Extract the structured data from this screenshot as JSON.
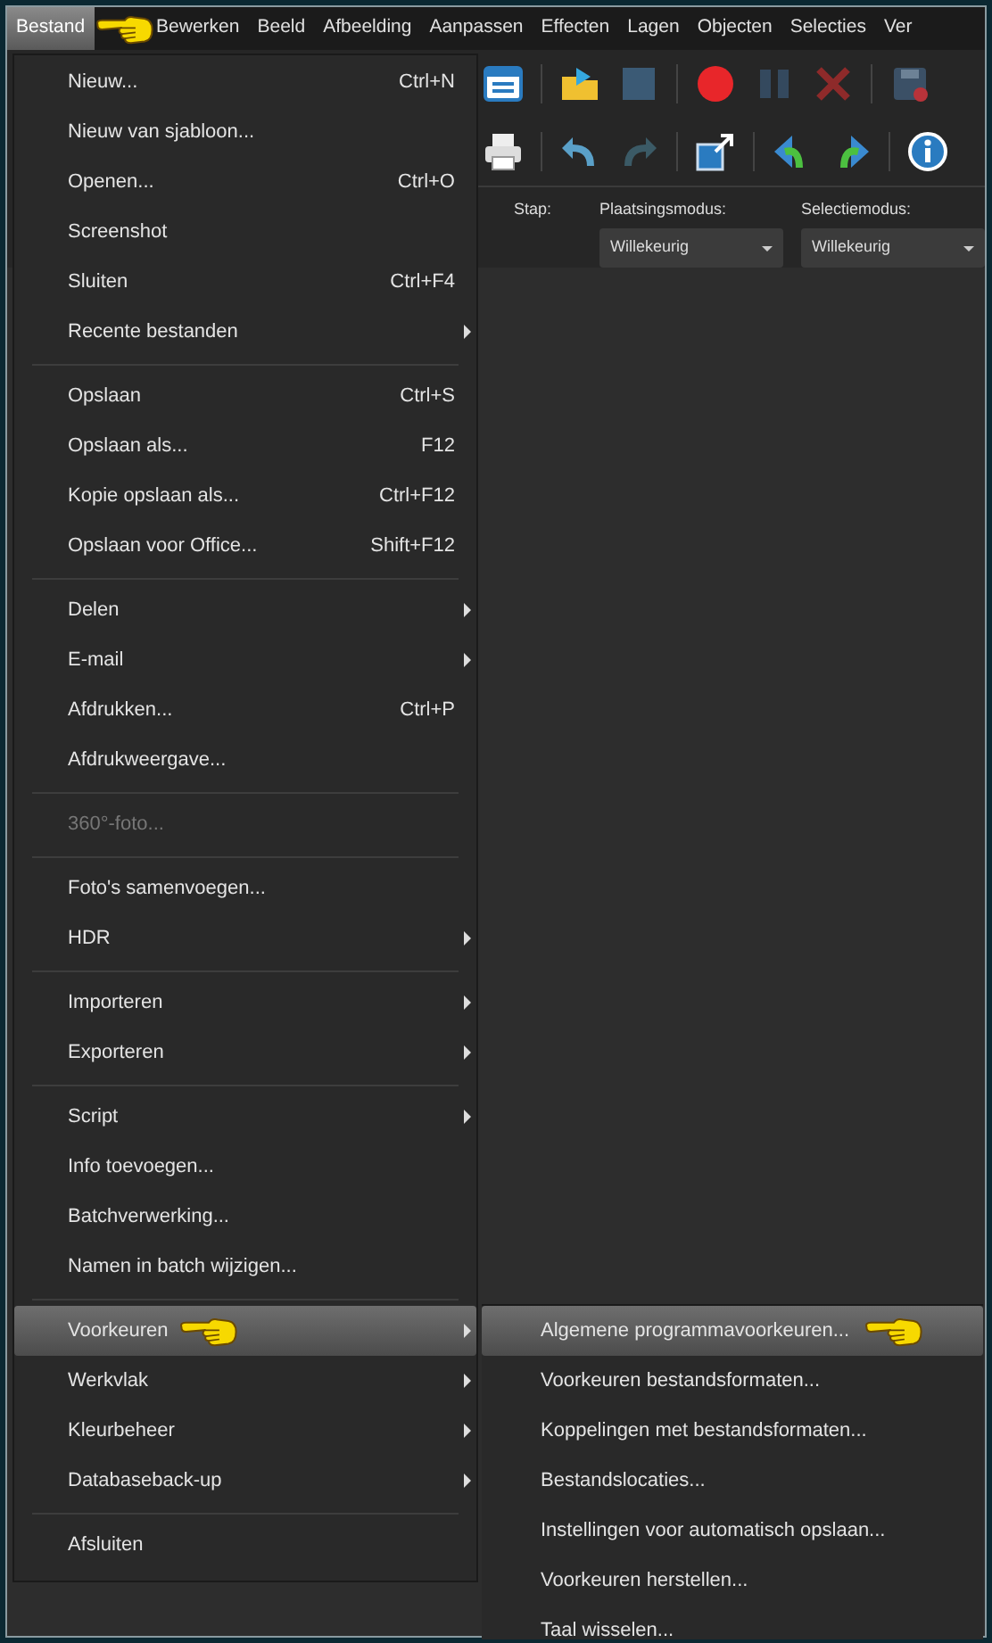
{
  "menu_bar": {
    "items": [
      {
        "label": "Bestand",
        "selected": true
      },
      {
        "label": "Bewerken",
        "selected": false
      },
      {
        "label": "Beeld",
        "selected": false
      },
      {
        "label": "Afbeelding",
        "selected": false
      },
      {
        "label": "Aanpassen",
        "selected": false
      },
      {
        "label": "Effecten",
        "selected": false
      },
      {
        "label": "Lagen",
        "selected": false
      },
      {
        "label": "Objecten",
        "selected": false
      },
      {
        "label": "Selecties",
        "selected": false
      },
      {
        "label": "Ver",
        "selected": false
      }
    ]
  },
  "toolbar": {
    "step_label": "Stap:",
    "placement_mode": {
      "label": "Plaatsingsmodus:",
      "value": "Willekeurig"
    },
    "selection_mode": {
      "label": "Selectiemodus:",
      "value": "Willekeurig"
    }
  },
  "file_menu": {
    "items": [
      {
        "kind": "item",
        "label": "Nieuw...",
        "shortcut": "Ctrl+N",
        "submenu": false,
        "disabled": false,
        "selected": false
      },
      {
        "kind": "item",
        "label": "Nieuw van sjabloon...",
        "submenu": false,
        "disabled": false,
        "selected": false
      },
      {
        "kind": "item",
        "label": "Openen...",
        "shortcut": "Ctrl+O",
        "submenu": false,
        "disabled": false,
        "selected": false
      },
      {
        "kind": "item",
        "label": "Screenshot",
        "submenu": false,
        "disabled": false,
        "selected": false
      },
      {
        "kind": "item",
        "label": "Sluiten",
        "shortcut": "Ctrl+F4",
        "submenu": false,
        "disabled": false,
        "selected": false
      },
      {
        "kind": "item",
        "label": "Recente bestanden",
        "submenu": true,
        "disabled": false,
        "selected": false
      },
      {
        "kind": "separator"
      },
      {
        "kind": "item",
        "label": "Opslaan",
        "shortcut": "Ctrl+S",
        "submenu": false,
        "disabled": false,
        "selected": false
      },
      {
        "kind": "item",
        "label": "Opslaan als...",
        "shortcut": "F12",
        "submenu": false,
        "disabled": false,
        "selected": false
      },
      {
        "kind": "item",
        "label": "Kopie opslaan als...",
        "shortcut": "Ctrl+F12",
        "submenu": false,
        "disabled": false,
        "selected": false
      },
      {
        "kind": "item",
        "label": "Opslaan voor Office...",
        "shortcut": "Shift+F12",
        "submenu": false,
        "disabled": false,
        "selected": false
      },
      {
        "kind": "separator"
      },
      {
        "kind": "item",
        "label": "Delen",
        "submenu": true,
        "disabled": false,
        "selected": false
      },
      {
        "kind": "item",
        "label": "E-mail",
        "submenu": true,
        "disabled": false,
        "selected": false
      },
      {
        "kind": "item",
        "label": "Afdrukken...",
        "shortcut": "Ctrl+P",
        "submenu": false,
        "disabled": false,
        "selected": false
      },
      {
        "kind": "item",
        "label": "Afdrukweergave...",
        "submenu": false,
        "disabled": false,
        "selected": false
      },
      {
        "kind": "separator"
      },
      {
        "kind": "item",
        "label": "360°-foto...",
        "submenu": false,
        "disabled": true,
        "selected": false
      },
      {
        "kind": "separator"
      },
      {
        "kind": "item",
        "label": "Foto's samenvoegen...",
        "submenu": false,
        "disabled": false,
        "selected": false
      },
      {
        "kind": "item",
        "label": "HDR",
        "submenu": true,
        "disabled": false,
        "selected": false
      },
      {
        "kind": "separator"
      },
      {
        "kind": "item",
        "label": "Importeren",
        "submenu": true,
        "disabled": false,
        "selected": false
      },
      {
        "kind": "item",
        "label": "Exporteren",
        "submenu": true,
        "disabled": false,
        "selected": false
      },
      {
        "kind": "separator"
      },
      {
        "kind": "item",
        "label": "Script",
        "submenu": true,
        "disabled": false,
        "selected": false
      },
      {
        "kind": "item",
        "label": "Info toevoegen...",
        "submenu": false,
        "disabled": false,
        "selected": false
      },
      {
        "kind": "item",
        "label": "Batchverwerking...",
        "submenu": false,
        "disabled": false,
        "selected": false
      },
      {
        "kind": "item",
        "label": "Namen in batch wijzigen...",
        "submenu": false,
        "disabled": false,
        "selected": false
      },
      {
        "kind": "separator"
      },
      {
        "kind": "item",
        "label": "Voorkeuren",
        "submenu": true,
        "disabled": false,
        "selected": true
      },
      {
        "kind": "item",
        "label": "Werkvlak",
        "submenu": true,
        "disabled": false,
        "selected": false
      },
      {
        "kind": "item",
        "label": "Kleurbeheer",
        "submenu": true,
        "disabled": false,
        "selected": false
      },
      {
        "kind": "item",
        "label": "Databaseback-up",
        "submenu": true,
        "disabled": false,
        "selected": false
      },
      {
        "kind": "separator"
      },
      {
        "kind": "item",
        "label": "Afsluiten",
        "submenu": false,
        "disabled": false,
        "selected": false
      }
    ]
  },
  "submenu": {
    "items": [
      {
        "label": "Algemene programmavoorkeuren...",
        "selected": true
      },
      {
        "label": "Voorkeuren bestandsformaten...",
        "selected": false
      },
      {
        "label": "Koppelingen met bestandsformaten...",
        "selected": false
      },
      {
        "label": "Bestandslocaties...",
        "selected": false
      },
      {
        "label": "Instellingen voor automatisch opslaan...",
        "selected": false
      },
      {
        "label": "Voorkeuren herstellen...",
        "selected": false
      },
      {
        "label": "Taal wisselen...",
        "selected": false
      }
    ]
  }
}
